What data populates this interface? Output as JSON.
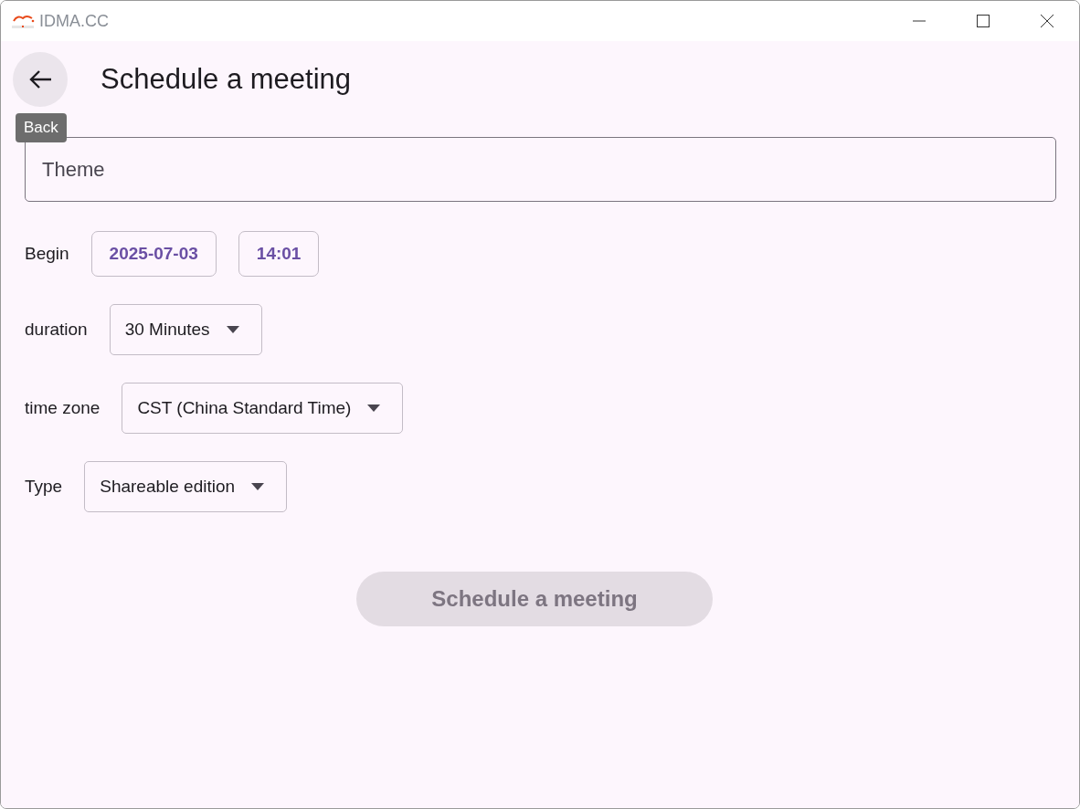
{
  "window": {
    "title": "IDMA.CC"
  },
  "header": {
    "title": "Schedule a meeting",
    "back_tooltip": "Back"
  },
  "theme_field": {
    "placeholder": "Theme"
  },
  "begin": {
    "label": "Begin",
    "date": "2025-07-03",
    "time": "14:01"
  },
  "dropdowns": [
    {
      "label": "duration",
      "value": "30 Minutes"
    },
    {
      "label": "time zone",
      "value": "CST (China Standard Time)"
    },
    {
      "label": "Type",
      "value": "Shareable edition"
    }
  ],
  "submit": {
    "label": "Schedule a meeting",
    "disabled": true
  }
}
